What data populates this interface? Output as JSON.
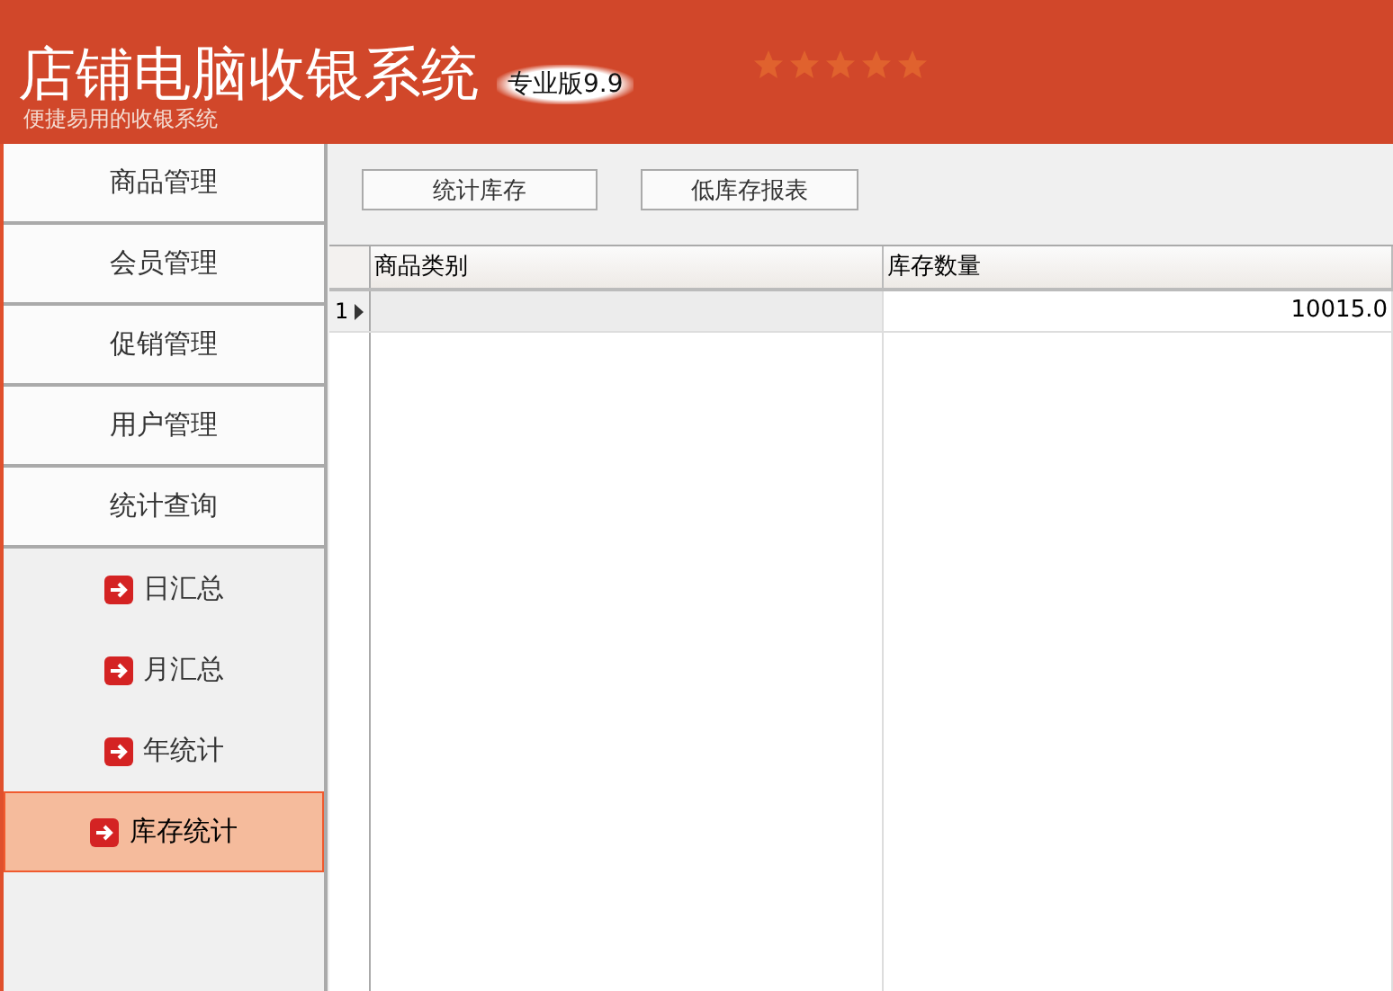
{
  "header": {
    "title": "店铺电脑收银系统",
    "edition": "专业版9.9",
    "subtitle": "便捷易用的收银系统"
  },
  "sidebar": {
    "sections": [
      {
        "label": "商品管理"
      },
      {
        "label": "会员管理"
      },
      {
        "label": "促销管理"
      },
      {
        "label": "用户管理"
      },
      {
        "label": "统计查询"
      }
    ],
    "items": [
      {
        "label": "日汇总",
        "selected": false
      },
      {
        "label": "月汇总",
        "selected": false
      },
      {
        "label": "年统计",
        "selected": false
      },
      {
        "label": "库存统计",
        "selected": true
      }
    ]
  },
  "toolbar": {
    "buttons": [
      "统计库存",
      "低库存报表"
    ]
  },
  "table": {
    "columns": [
      "商品类别",
      "库存数量"
    ],
    "rows": [
      {
        "number": "1",
        "current": true,
        "cells": [
          "",
          "10015.0"
        ]
      }
    ]
  }
}
